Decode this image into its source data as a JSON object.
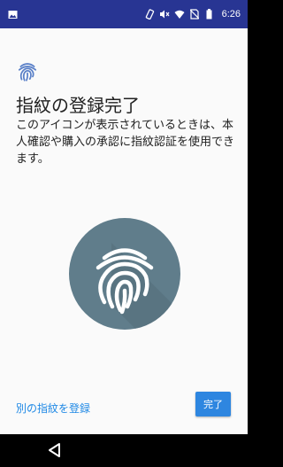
{
  "status_bar": {
    "time": "6:26",
    "icons": [
      "image-icon",
      "vibrate-icon",
      "mute-icon",
      "wifi-icon",
      "no-sim-icon",
      "battery-icon"
    ]
  },
  "content": {
    "title": "指紋の登録完了",
    "description": "このアイコンが表示されているときは、本人確認や購入の承認に指紋認証を使用できます。"
  },
  "actions": {
    "add_another": "別の指紋を登録",
    "done": "完了"
  },
  "colors": {
    "status_bar": "#283593",
    "accent": "#2e86e0",
    "fingerprint_circle": "#607d8b"
  }
}
